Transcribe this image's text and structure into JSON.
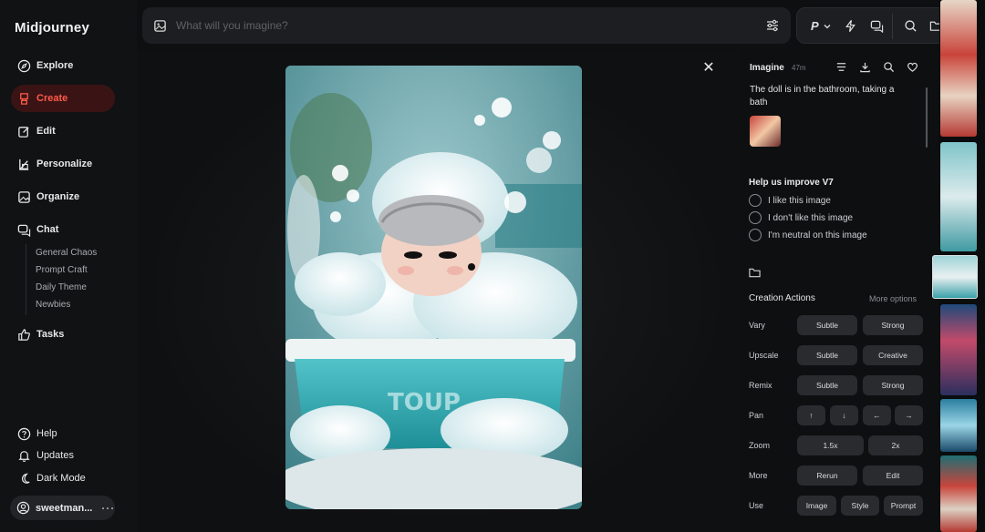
{
  "app": {
    "title": "Midjourney"
  },
  "sidebar": {
    "items": [
      {
        "label": "Explore",
        "icon": "compass-icon"
      },
      {
        "label": "Create",
        "icon": "brush-icon",
        "active": true
      },
      {
        "label": "Edit",
        "icon": "edit-icon"
      },
      {
        "label": "Personalize",
        "icon": "personalize-icon"
      },
      {
        "label": "Organize",
        "icon": "image-icon"
      },
      {
        "label": "Chat",
        "icon": "chat-icon"
      },
      {
        "label": "Tasks",
        "icon": "thumbs-up-icon"
      }
    ],
    "chat_rooms": [
      "General Chaos",
      "Prompt Craft",
      "Daily Theme",
      "Newbies"
    ],
    "bottom": [
      {
        "label": "Help",
        "icon": "help-icon"
      },
      {
        "label": "Updates",
        "icon": "bell-icon"
      },
      {
        "label": "Dark Mode",
        "icon": "moon-icon"
      }
    ],
    "user": {
      "name": "sweetman...",
      "more": "···"
    }
  },
  "search": {
    "placeholder": "What will you imagine?"
  },
  "tools": {
    "param_label": "P"
  },
  "detail": {
    "heading": "Imagine",
    "time": "47m",
    "prompt": "The doll is in the bathroom, taking a bath",
    "improve_title": "Help us improve V7",
    "feedback": [
      "I like this image",
      "I don't like this image",
      "I'm neutral on this image"
    ],
    "actions_title": "Creation Actions",
    "more_options": "More options",
    "rows": [
      {
        "label": "Vary",
        "buttons": [
          "Subtle",
          "Strong"
        ]
      },
      {
        "label": "Upscale",
        "buttons": [
          "Subtle",
          "Creative"
        ]
      },
      {
        "label": "Remix",
        "buttons": [
          "Subtle",
          "Strong"
        ]
      },
      {
        "label": "Pan",
        "buttons": [
          "↑",
          "↓",
          "←",
          "→"
        ]
      },
      {
        "label": "Zoom",
        "buttons": [
          "1.5x",
          "2x"
        ]
      },
      {
        "label": "More",
        "buttons": [
          "Rerun",
          "Edit"
        ]
      },
      {
        "label": "Use",
        "buttons": [
          "Image",
          "Style",
          "Prompt"
        ]
      }
    ]
  },
  "image": {
    "tub_text": "TOUP"
  },
  "colors": {
    "accent": "#ff5a4a",
    "active_bg": "#3a1414",
    "panel_bg": "#0e0f11"
  }
}
